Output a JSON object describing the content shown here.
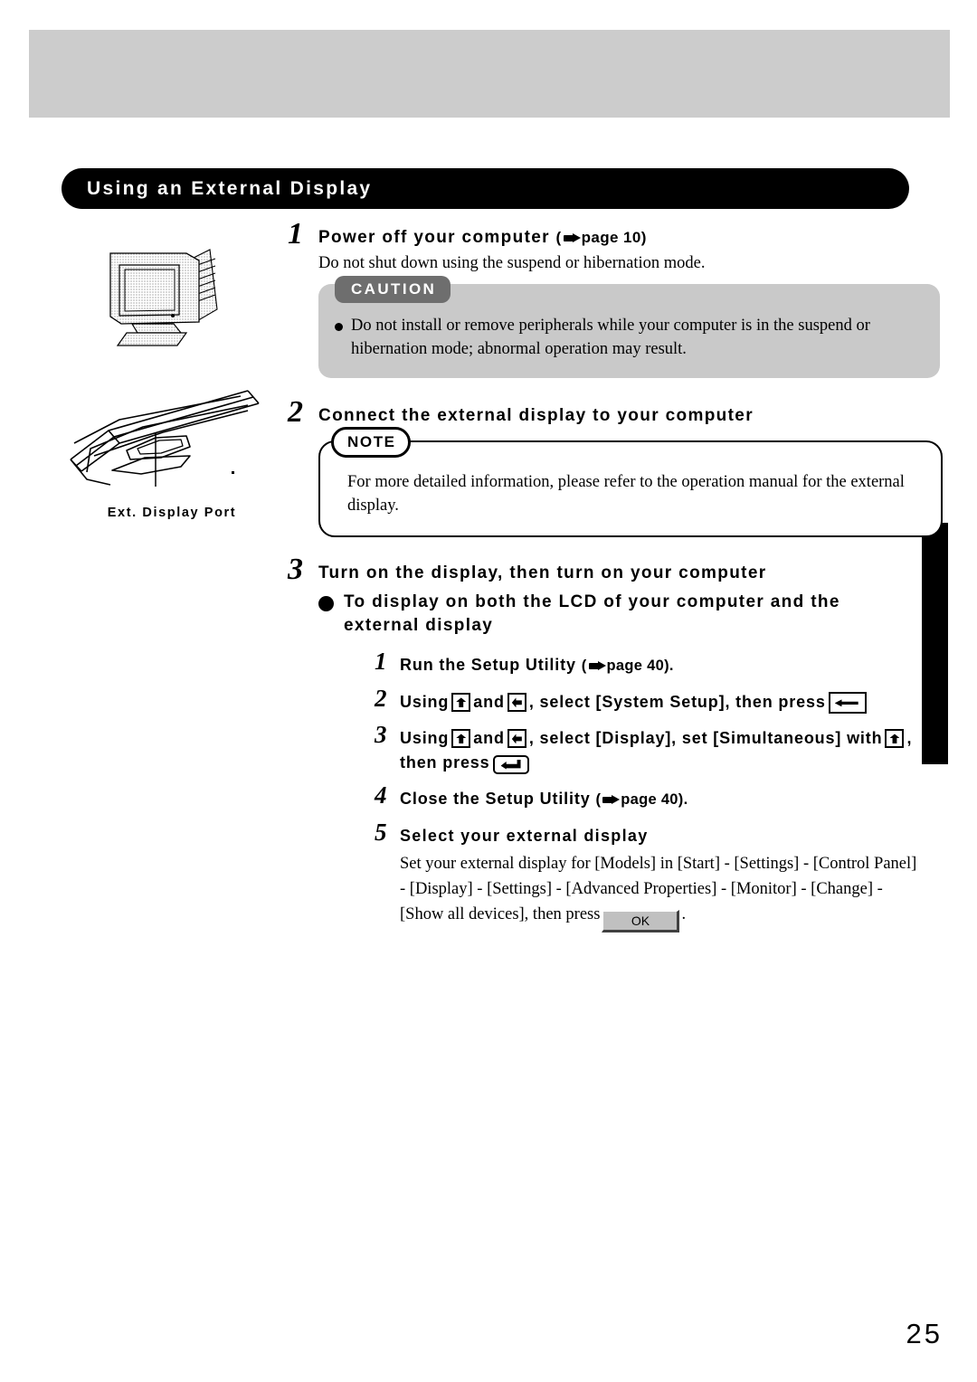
{
  "page": {
    "number": "25",
    "section_title": "Using an External Display"
  },
  "illustrations": {
    "monitor_alt": "external CRT display illustration",
    "port_alt": "laptop rear port illustration",
    "port_caption": "Ext. Display Port"
  },
  "steps": [
    {
      "number": "1",
      "heading": "Power off your computer",
      "ref_open": "(",
      "ref_text": "page 10)",
      "subtext": "Do not shut down using the suspend or hibernation mode."
    },
    {
      "number": "2",
      "heading": "Connect the external display to your computer"
    },
    {
      "number": "3",
      "heading": "Turn on the display, then turn on your computer"
    }
  ],
  "caution": {
    "tag": "CAUTION",
    "text": "Do not install or remove peripherals while your computer is in the suspend or hibernation mode; abnormal operation may result."
  },
  "note": {
    "tag": "NOTE",
    "text": "For more detailed information, please refer to the operation manual for the external display."
  },
  "bullet_heading": "To display on both the LCD of your computer and the external display",
  "substeps": [
    {
      "number": "1",
      "text_a": "Run the Setup Utility",
      "ref_open": "(",
      "ref_text": "page 40)."
    },
    {
      "number": "2",
      "text_a": "Using",
      "text_b": "and",
      "text_c": ", select [System Setup], then press"
    },
    {
      "number": "3",
      "text_a": "Using",
      "text_b": "and",
      "text_c": ", select [Display], set [Simultaneous] with",
      "text_d": ", then press"
    },
    {
      "number": "4",
      "text_a": "Close the Setup Utility",
      "ref_open": "(",
      "ref_text": "page 40)."
    },
    {
      "number": "5",
      "text_a": "Select your external display",
      "body_1": "Set your external display for  [Models] in [Start] - [Settings] - [Control Panel] - [Display] - [Settings] - [Advanced Properties] - [Monitor] - [Change] - [Show all devices], then press",
      "body_2": ".",
      "ok_label": "OK"
    }
  ],
  "icons": {
    "hand_pointer": "hand-pointer-icon",
    "key_up_down": "key-updown-icon",
    "key_left_right": "key-leftright-icon",
    "key_spacebar": "key-spacebar-icon",
    "key_enter": "key-enter-icon"
  }
}
